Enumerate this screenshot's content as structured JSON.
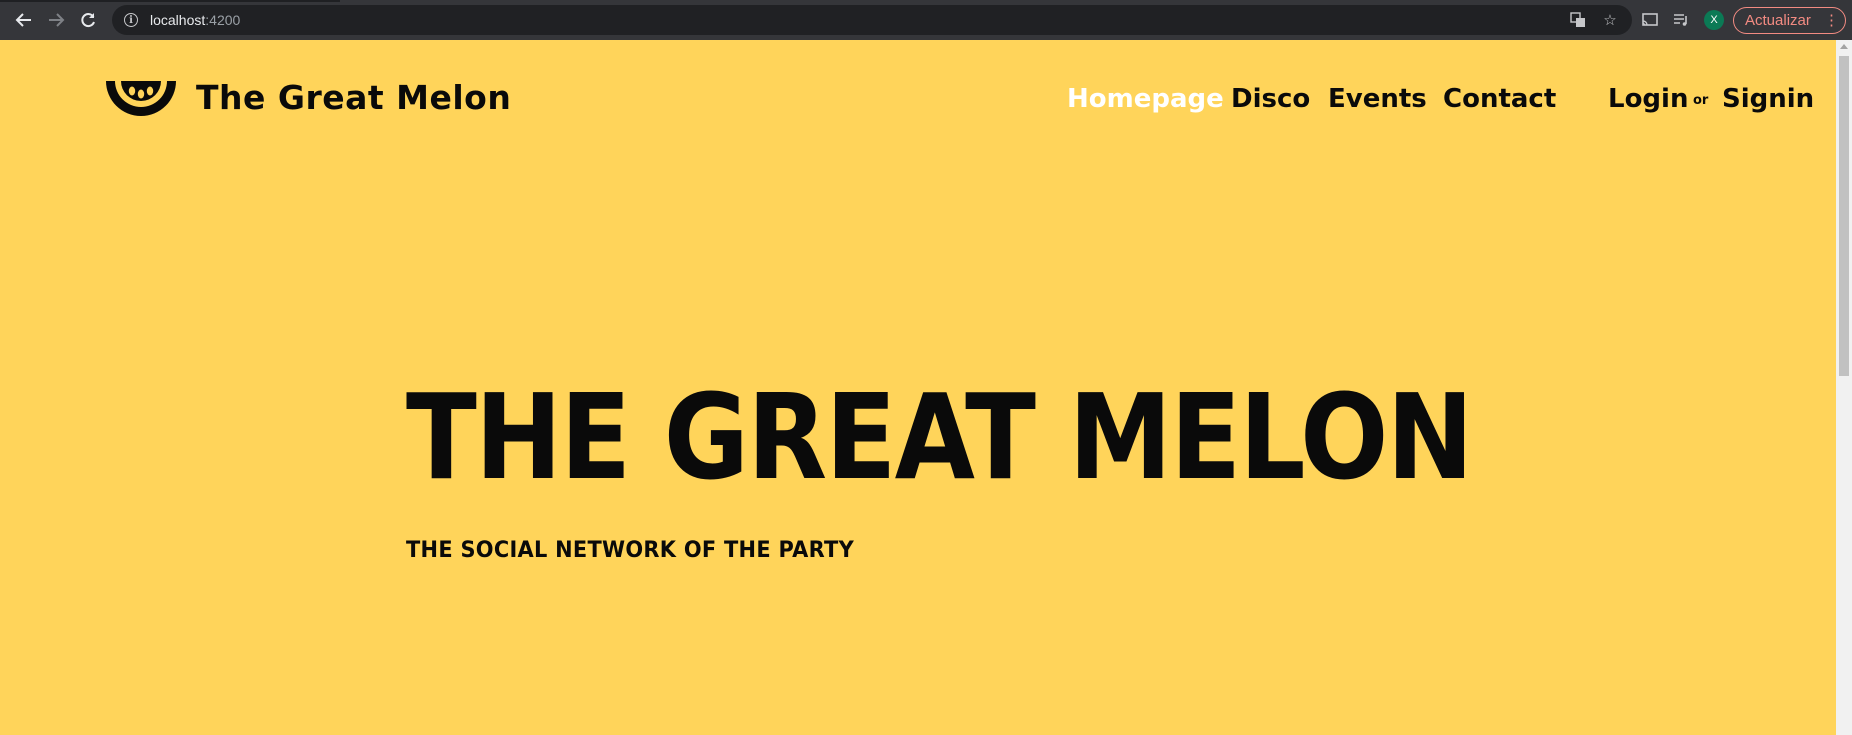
{
  "browser": {
    "url_host": "localhost",
    "url_port": ":4200",
    "profile_initial": "X",
    "update_label": "Actualizar"
  },
  "site": {
    "brand": "The Great Melon",
    "nav": {
      "homepage": "Homepage",
      "disco": "Disco",
      "events": "Events",
      "contact": "Contact",
      "login": "Login",
      "or": "or",
      "signin": "Signin"
    },
    "hero": {
      "title": "THE GREAT MELON",
      "subtitle": "THE SOCIAL NETWORK OF THE PARTY"
    },
    "colors": {
      "background": "#ffd45a",
      "text": "#0a0a0a",
      "active_link": "#ffffff"
    }
  }
}
